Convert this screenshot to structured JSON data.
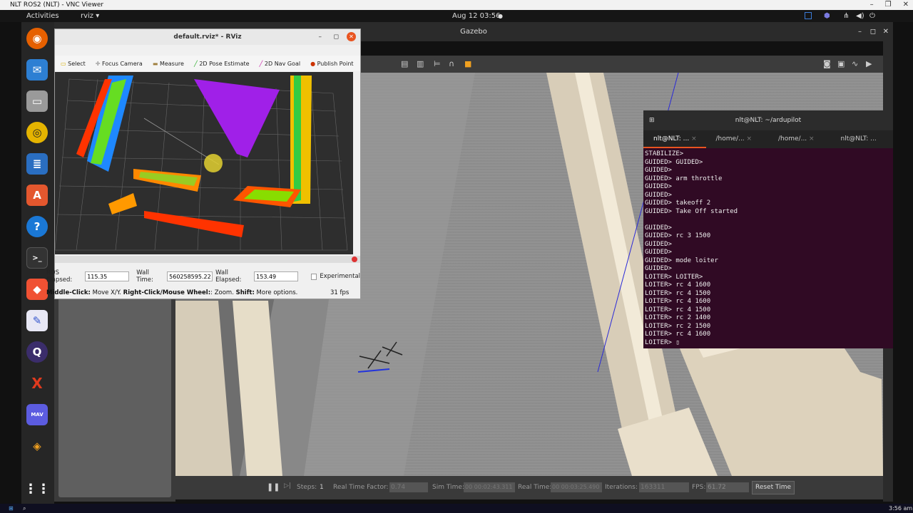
{
  "vnc": {
    "title": "NLT ROS2 (NLT) - VNC Viewer"
  },
  "topbar": {
    "activities": "Activities",
    "app_menu": "rviz ▾",
    "datetime": "Aug 12  03:56",
    "dot": "●"
  },
  "dock_items": [
    "firefox-icon",
    "mail-icon",
    "files-icon",
    "rhythmbox-icon",
    "writer-icon",
    "appstore-icon",
    "help-icon",
    "terminal-icon",
    "git-icon",
    "editor-icon",
    "qgroundcontrol-icon",
    "xlaunch-icon",
    "mavconsole-icon",
    "layers-icon",
    "apps-grid-icon"
  ],
  "gazebo": {
    "title": "Gazebo",
    "bottom": {
      "steps_label": "Steps:",
      "steps_value": "1",
      "rtf_label": "Real Time Factor:",
      "rtf_value": "0.74",
      "sim_label": "Sim Time:",
      "sim_value": "00 00:02:43.311",
      "real_label": "Real Time:",
      "real_value": "00 00:03:25.490",
      "iter_label": "Iterations:",
      "iter_value": "163311",
      "fps_label": "FPS:",
      "fps_value": "61.72",
      "reset_label": "Reset Time"
    }
  },
  "rviz": {
    "title": "default.rviz* - RViz",
    "tools": [
      "Select",
      "Focus Camera",
      "Measure",
      "2D Pose Estimate",
      "2D Nav Goal",
      "Publish Point"
    ],
    "ros_elapsed_label": "ROS Elapsed:",
    "ros_elapsed_value": "115.35",
    "wall_time_label": "Wall Time:",
    "wall_time_value": "560258595.22",
    "wall_elapsed_label": "Wall Elapsed:",
    "wall_elapsed_value": "153.49",
    "experimental_label": "Experimental",
    "hint_mid": "Middle-Click:",
    "hint_mid_text": " Move X/Y. ",
    "hint_right": "Right-Click/Mouse Wheel:",
    "hint_right_text": ": Zoom. ",
    "hint_shift": "Shift:",
    "hint_shift_text": " More options.",
    "fps": "31 fps"
  },
  "terminal": {
    "title": "nlt@NLT: ~/ardupilot",
    "tabs": [
      "nlt@NLT: ...",
      "/home/...",
      "/home/...",
      "nlt@NLT: ..."
    ],
    "lines": [
      "STABILIZE>",
      "GUIDED> GUIDED>",
      "GUIDED>",
      "GUIDED> arm throttle",
      "GUIDED>",
      "GUIDED>",
      "GUIDED> takeoff 2",
      "GUIDED> Take Off started",
      "",
      "GUIDED>",
      "GUIDED> rc 3 1500",
      "GUIDED>",
      "GUIDED>",
      "GUIDED> mode loiter",
      "GUIDED>",
      "LOITER> LOITER>",
      "LOITER> rc 4 1600",
      "LOITER> rc 4 1500",
      "LOITER> rc 4 1600",
      "LOITER> rc 4 1500",
      "LOITER> rc 2 1400",
      "LOITER> rc 2 1500",
      "LOITER> rc 4 1600",
      "LOITER> ▯"
    ]
  },
  "taskbar": {
    "time": "3:56 am"
  }
}
